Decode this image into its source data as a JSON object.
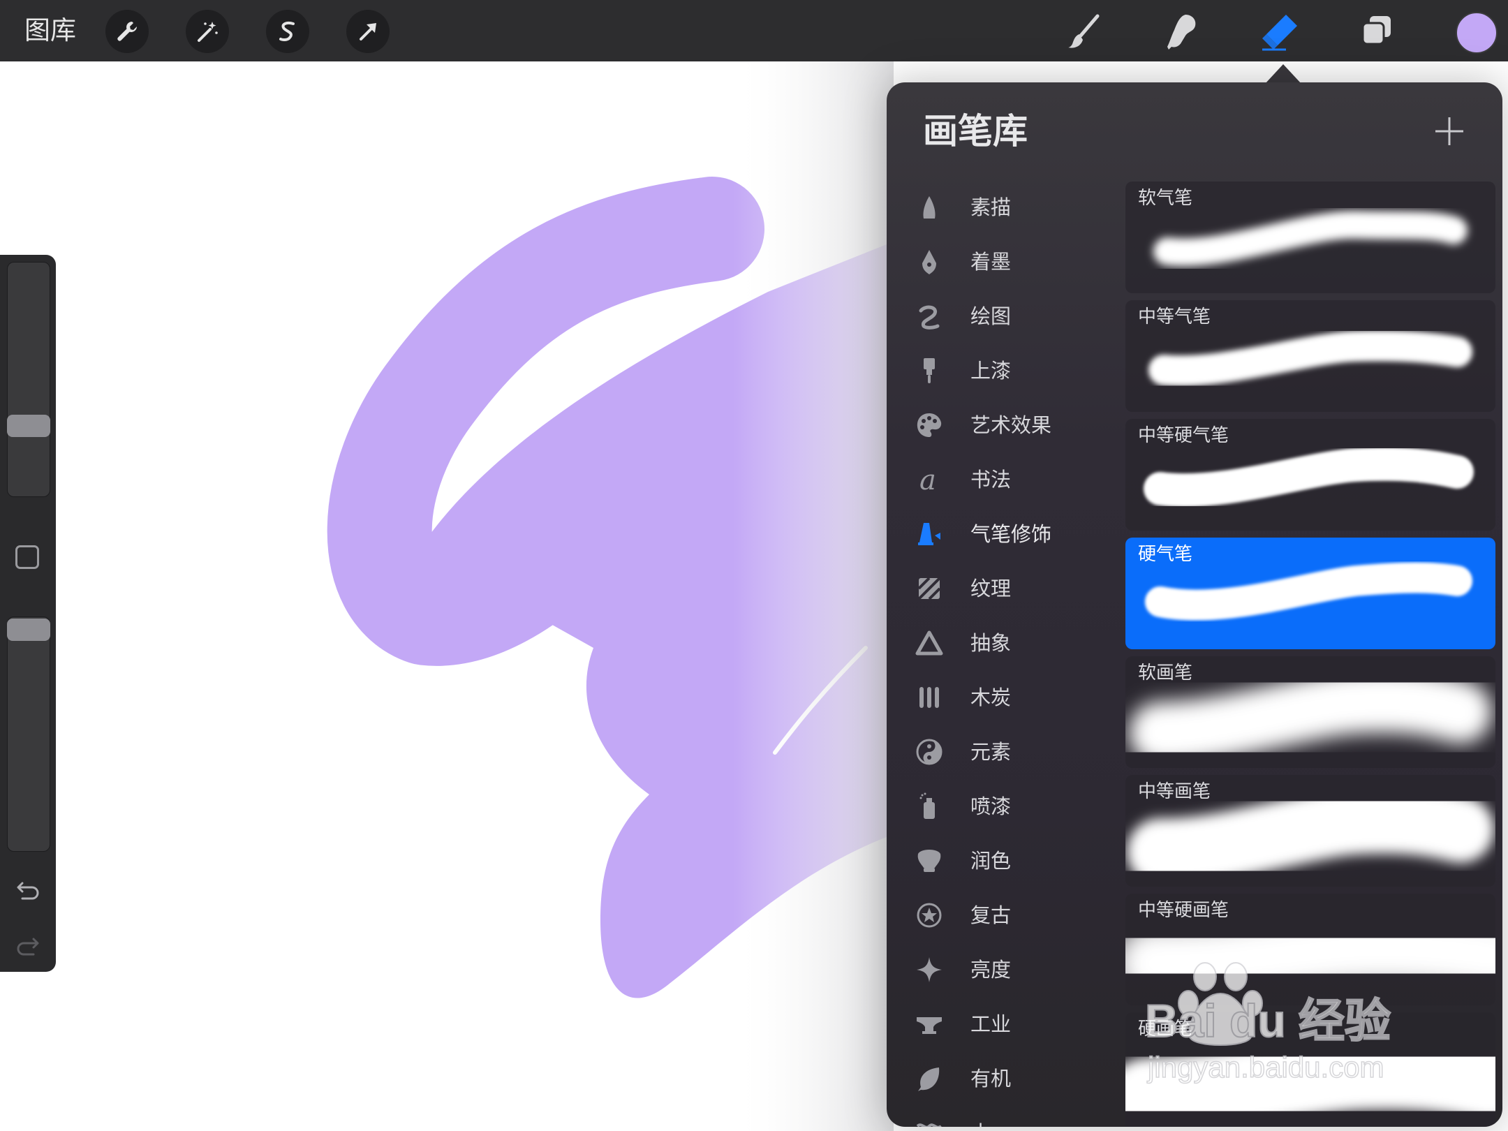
{
  "topbar": {
    "gallery_label": "图库",
    "adjust_tools": [
      {
        "icon": "wrench-icon"
      },
      {
        "icon": "magic-wand-icon"
      },
      {
        "icon": "selection-s-icon"
      },
      {
        "icon": "transform-arrow-icon"
      }
    ],
    "tools": [
      {
        "icon": "paintbrush-icon"
      },
      {
        "icon": "smudge-icon"
      },
      {
        "icon": "eraser-icon",
        "active": true
      },
      {
        "icon": "layers-icon"
      }
    ],
    "current_color": "#c3a8f6"
  },
  "canvas": {
    "stroke_color": "#c3a8f6"
  },
  "sidebar": {
    "modify_icon": "square-icon",
    "undo_icon": "undo-icon",
    "redo_icon": "redo-icon"
  },
  "brush_library": {
    "title": "画笔库",
    "add_icon": "plus-icon",
    "categories": [
      {
        "label": "素描",
        "icon": "pencil-tip-icon"
      },
      {
        "label": "着墨",
        "icon": "ink-nib-icon"
      },
      {
        "label": "绘图",
        "icon": "squiggle-icon"
      },
      {
        "label": "上漆",
        "icon": "paint-brush-icon"
      },
      {
        "label": "艺术效果",
        "icon": "palette-icon"
      },
      {
        "label": "书法",
        "icon": "calligraphy-icon"
      },
      {
        "label": "气笔修饰",
        "icon": "airbrush-icon",
        "active": true
      },
      {
        "label": "纹理",
        "icon": "texture-icon"
      },
      {
        "label": "抽象",
        "icon": "triangle-icon"
      },
      {
        "label": "木炭",
        "icon": "charcoal-icon"
      },
      {
        "label": "元素",
        "icon": "yin-yang-icon"
      },
      {
        "label": "喷漆",
        "icon": "spray-can-icon"
      },
      {
        "label": "润色",
        "icon": "touchup-icon"
      },
      {
        "label": "复古",
        "icon": "star-badge-icon"
      },
      {
        "label": "亮度",
        "icon": "sparkle-icon"
      },
      {
        "label": "工业",
        "icon": "anvil-icon"
      },
      {
        "label": "有机",
        "icon": "leaf-icon"
      },
      {
        "label": "水",
        "icon": "waves-icon"
      }
    ],
    "brushes": [
      {
        "name": "软气笔"
      },
      {
        "name": "中等气笔"
      },
      {
        "name": "中等硬气笔"
      },
      {
        "name": "硬气笔",
        "selected": true
      },
      {
        "name": "软画笔"
      },
      {
        "name": "中等画笔"
      },
      {
        "name": "中等硬画笔"
      },
      {
        "name": "硬画笔"
      }
    ],
    "accent_color": "#0a6dfa"
  },
  "watermark": {
    "brand": "Bai du 经验",
    "url": "jingyan.baidu.com"
  }
}
